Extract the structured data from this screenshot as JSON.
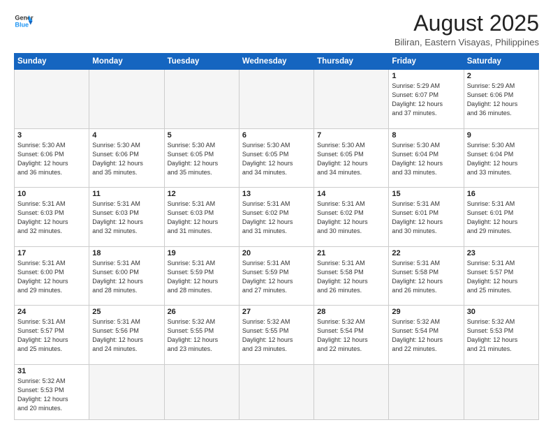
{
  "header": {
    "logo_general": "General",
    "logo_blue": "Blue",
    "month_year": "August 2025",
    "location": "Biliran, Eastern Visayas, Philippines"
  },
  "days_of_week": [
    "Sunday",
    "Monday",
    "Tuesday",
    "Wednesday",
    "Thursday",
    "Friday",
    "Saturday"
  ],
  "weeks": [
    [
      {
        "num": "",
        "info": ""
      },
      {
        "num": "",
        "info": ""
      },
      {
        "num": "",
        "info": ""
      },
      {
        "num": "",
        "info": ""
      },
      {
        "num": "",
        "info": ""
      },
      {
        "num": "1",
        "info": "Sunrise: 5:29 AM\nSunset: 6:07 PM\nDaylight: 12 hours\nand 37 minutes."
      },
      {
        "num": "2",
        "info": "Sunrise: 5:29 AM\nSunset: 6:06 PM\nDaylight: 12 hours\nand 36 minutes."
      }
    ],
    [
      {
        "num": "3",
        "info": "Sunrise: 5:30 AM\nSunset: 6:06 PM\nDaylight: 12 hours\nand 36 minutes."
      },
      {
        "num": "4",
        "info": "Sunrise: 5:30 AM\nSunset: 6:06 PM\nDaylight: 12 hours\nand 35 minutes."
      },
      {
        "num": "5",
        "info": "Sunrise: 5:30 AM\nSunset: 6:05 PM\nDaylight: 12 hours\nand 35 minutes."
      },
      {
        "num": "6",
        "info": "Sunrise: 5:30 AM\nSunset: 6:05 PM\nDaylight: 12 hours\nand 34 minutes."
      },
      {
        "num": "7",
        "info": "Sunrise: 5:30 AM\nSunset: 6:05 PM\nDaylight: 12 hours\nand 34 minutes."
      },
      {
        "num": "8",
        "info": "Sunrise: 5:30 AM\nSunset: 6:04 PM\nDaylight: 12 hours\nand 33 minutes."
      },
      {
        "num": "9",
        "info": "Sunrise: 5:30 AM\nSunset: 6:04 PM\nDaylight: 12 hours\nand 33 minutes."
      }
    ],
    [
      {
        "num": "10",
        "info": "Sunrise: 5:31 AM\nSunset: 6:03 PM\nDaylight: 12 hours\nand 32 minutes."
      },
      {
        "num": "11",
        "info": "Sunrise: 5:31 AM\nSunset: 6:03 PM\nDaylight: 12 hours\nand 32 minutes."
      },
      {
        "num": "12",
        "info": "Sunrise: 5:31 AM\nSunset: 6:03 PM\nDaylight: 12 hours\nand 31 minutes."
      },
      {
        "num": "13",
        "info": "Sunrise: 5:31 AM\nSunset: 6:02 PM\nDaylight: 12 hours\nand 31 minutes."
      },
      {
        "num": "14",
        "info": "Sunrise: 5:31 AM\nSunset: 6:02 PM\nDaylight: 12 hours\nand 30 minutes."
      },
      {
        "num": "15",
        "info": "Sunrise: 5:31 AM\nSunset: 6:01 PM\nDaylight: 12 hours\nand 30 minutes."
      },
      {
        "num": "16",
        "info": "Sunrise: 5:31 AM\nSunset: 6:01 PM\nDaylight: 12 hours\nand 29 minutes."
      }
    ],
    [
      {
        "num": "17",
        "info": "Sunrise: 5:31 AM\nSunset: 6:00 PM\nDaylight: 12 hours\nand 29 minutes."
      },
      {
        "num": "18",
        "info": "Sunrise: 5:31 AM\nSunset: 6:00 PM\nDaylight: 12 hours\nand 28 minutes."
      },
      {
        "num": "19",
        "info": "Sunrise: 5:31 AM\nSunset: 5:59 PM\nDaylight: 12 hours\nand 28 minutes."
      },
      {
        "num": "20",
        "info": "Sunrise: 5:31 AM\nSunset: 5:59 PM\nDaylight: 12 hours\nand 27 minutes."
      },
      {
        "num": "21",
        "info": "Sunrise: 5:31 AM\nSunset: 5:58 PM\nDaylight: 12 hours\nand 26 minutes."
      },
      {
        "num": "22",
        "info": "Sunrise: 5:31 AM\nSunset: 5:58 PM\nDaylight: 12 hours\nand 26 minutes."
      },
      {
        "num": "23",
        "info": "Sunrise: 5:31 AM\nSunset: 5:57 PM\nDaylight: 12 hours\nand 25 minutes."
      }
    ],
    [
      {
        "num": "24",
        "info": "Sunrise: 5:31 AM\nSunset: 5:57 PM\nDaylight: 12 hours\nand 25 minutes."
      },
      {
        "num": "25",
        "info": "Sunrise: 5:31 AM\nSunset: 5:56 PM\nDaylight: 12 hours\nand 24 minutes."
      },
      {
        "num": "26",
        "info": "Sunrise: 5:32 AM\nSunset: 5:55 PM\nDaylight: 12 hours\nand 23 minutes."
      },
      {
        "num": "27",
        "info": "Sunrise: 5:32 AM\nSunset: 5:55 PM\nDaylight: 12 hours\nand 23 minutes."
      },
      {
        "num": "28",
        "info": "Sunrise: 5:32 AM\nSunset: 5:54 PM\nDaylight: 12 hours\nand 22 minutes."
      },
      {
        "num": "29",
        "info": "Sunrise: 5:32 AM\nSunset: 5:54 PM\nDaylight: 12 hours\nand 22 minutes."
      },
      {
        "num": "30",
        "info": "Sunrise: 5:32 AM\nSunset: 5:53 PM\nDaylight: 12 hours\nand 21 minutes."
      }
    ],
    [
      {
        "num": "31",
        "info": "Sunrise: 5:32 AM\nSunset: 5:53 PM\nDaylight: 12 hours\nand 20 minutes."
      },
      {
        "num": "",
        "info": ""
      },
      {
        "num": "",
        "info": ""
      },
      {
        "num": "",
        "info": ""
      },
      {
        "num": "",
        "info": ""
      },
      {
        "num": "",
        "info": ""
      },
      {
        "num": "",
        "info": ""
      }
    ]
  ]
}
